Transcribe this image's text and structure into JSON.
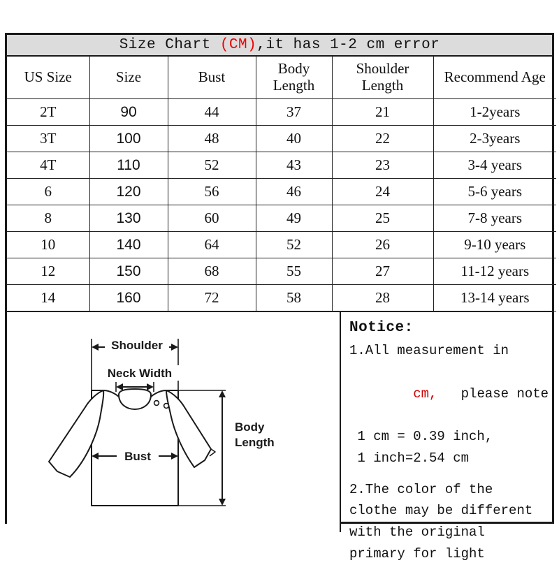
{
  "title": {
    "prefix": "Size Chart ",
    "unit": "(CM)",
    "suffix": ",it has 1-2 cm error",
    "unit_color": "#ee0000"
  },
  "table": {
    "columns": [
      "US Size",
      "Size",
      "Bust",
      "Body\nLength",
      "Shoulder\nLength",
      "Recommend Age"
    ],
    "rows": [
      [
        "2T",
        "90",
        "44",
        "37",
        "21",
        "1-2years"
      ],
      [
        "3T",
        "100",
        "48",
        "40",
        "22",
        "2-3years"
      ],
      [
        "4T",
        "110",
        "52",
        "43",
        "23",
        "3-4 years"
      ],
      [
        "6",
        "120",
        "56",
        "46",
        "24",
        "5-6 years"
      ],
      [
        "8",
        "130",
        "60",
        "49",
        "25",
        "7-8 years"
      ],
      [
        "10",
        "140",
        "64",
        "52",
        "26",
        "9-10 years"
      ],
      [
        "12",
        "150",
        "68",
        "55",
        "27",
        "11-12 years"
      ],
      [
        "14",
        "160",
        "72",
        "58",
        "28",
        "13-14 years"
      ]
    ]
  },
  "diagram": {
    "labels": {
      "shoulder": "Shoulder",
      "neck_width": "Neck Width",
      "bust": "Bust",
      "body_length_line1": "Body",
      "body_length_line2": "Length"
    }
  },
  "notice": {
    "heading": "Notice:",
    "item1_line1": "1.All measurement in",
    "item1_unit": "cm,",
    "item1_line2_rest": "   please note",
    "item1_line3": " 1 cm = 0.39 inch,",
    "item1_line4": " 1 inch=2.54 cm",
    "item2_line1": "2.The color of the",
    "item2_line2": "clothe may be different",
    "item2_line3": "with the original",
    "item2_line4": "primary for light",
    "unit_color": "#cc0000"
  }
}
